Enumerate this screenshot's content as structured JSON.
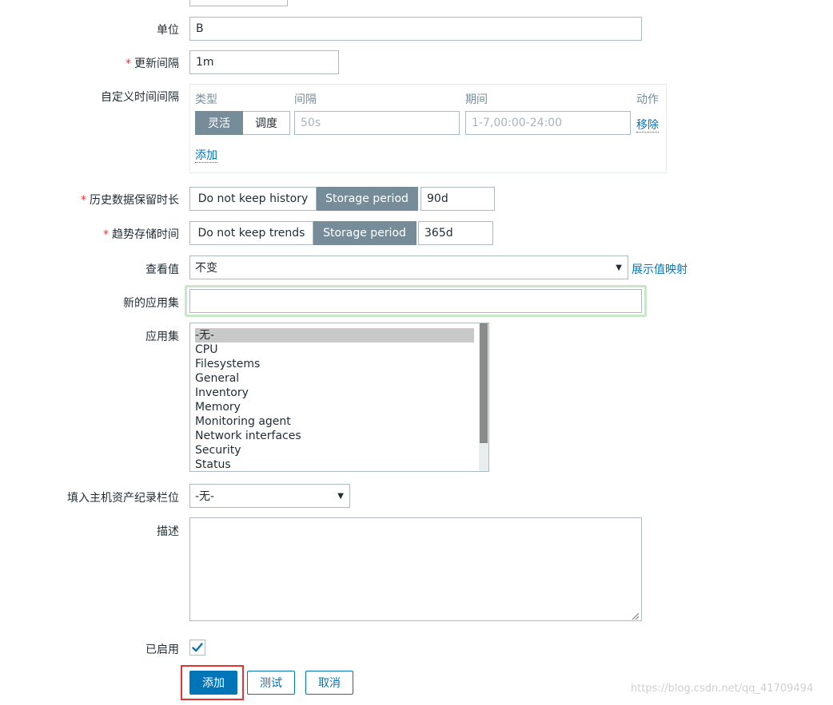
{
  "form": {
    "unit": {
      "label": "单位",
      "value": "B"
    },
    "update_interval": {
      "required_mark": "*",
      "label": "更新间隔",
      "value": "1m"
    },
    "custom_intervals": {
      "label": "自定义时间间隔",
      "headers": {
        "type": "类型",
        "interval": "间隔",
        "period": "期间",
        "action": "动作"
      },
      "type_options": {
        "flexible": "灵活",
        "scheduling": "调度"
      },
      "interval_placeholder": "50s",
      "period_placeholder": "1-7,00:00-24:00",
      "remove_label": "移除",
      "add_label": "添加"
    },
    "history": {
      "required_mark": "*",
      "label": "历史数据保留时长",
      "option_no_keep": "Do not keep history",
      "option_storage": "Storage period",
      "value": "90d"
    },
    "trends": {
      "required_mark": "*",
      "label": "趋势存储时间",
      "option_no_keep": "Do not keep trends",
      "option_storage": "Storage period",
      "value": "365d"
    },
    "show_value": {
      "label": "查看值",
      "selected": "不变",
      "link": "展示值映射"
    },
    "new_application": {
      "label": "新的应用集",
      "value": ""
    },
    "applications": {
      "label": "应用集",
      "items": [
        "-无-",
        "CPU",
        "Filesystems",
        "General",
        "Inventory",
        "Memory",
        "Monitoring agent",
        "Network interfaces",
        "Security",
        "Status"
      ]
    },
    "inventory_field": {
      "label": "填入主机资产纪录栏位",
      "selected": "-无-"
    },
    "description": {
      "label": "描述",
      "value": ""
    },
    "enabled": {
      "label": "已启用",
      "checked": true
    }
  },
  "buttons": {
    "add": "添加",
    "test": "测试",
    "cancel": "取消"
  },
  "watermark": "https://blog.csdn.net/qq_41709494",
  "colors": {
    "accent": "#0275b8",
    "active_segment": "#768d99",
    "required": "#e33734",
    "highlight_border": "#c9e6c9",
    "annotation_box": "#e53333"
  }
}
